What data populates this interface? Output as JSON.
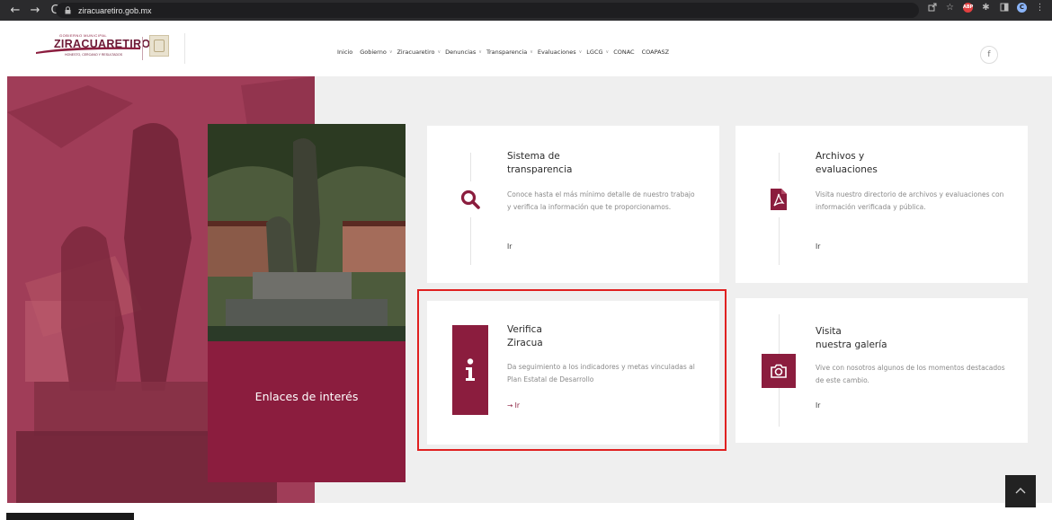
{
  "browser": {
    "back": "←",
    "forward": "→",
    "reload": "C",
    "lock": "🔒",
    "url": "ziracuaretiro.gob.mx",
    "profile": "C"
  },
  "logo": {
    "top": "GOBIERNO MUNICIPAL",
    "name": "ZIRACUARETIRO",
    "tagline": "HONESTO, CERCANO Y RESULTADOS"
  },
  "nav": {
    "items": [
      {
        "label": "Inicio",
        "caret": false
      },
      {
        "label": "Gobierno",
        "caret": true
      },
      {
        "label": "Ziracuaretiro",
        "caret": true
      },
      {
        "label": "Denuncias",
        "caret": true
      },
      {
        "label": "Transparencia",
        "caret": true
      },
      {
        "label": "Evaluaciones",
        "caret": true
      },
      {
        "label": "LGCG",
        "caret": true
      },
      {
        "label": "CONAC",
        "caret": false
      },
      {
        "label": "COAPASZ",
        "caret": false
      }
    ],
    "caret_glyph": "∨",
    "facebook": "f"
  },
  "feature": {
    "label": "Enlaces de interés"
  },
  "cards": [
    {
      "title_line1": "Sistema de",
      "title_line2": "transparencia",
      "desc": "Conoce hasta el más mínimo detalle de nuestro trabajo y verifica la información que te proporcionamos.",
      "link": "Ir",
      "icon": "search-icon"
    },
    {
      "title_line1": "Archivos y",
      "title_line2": "evaluaciones",
      "desc": "Visita nuestro directorio de archivos y evaluaciones con información verificada y pública.",
      "link": "Ir",
      "icon": "pdf-icon"
    },
    {
      "title_line1": "Verifica",
      "title_line2": "Ziracua",
      "desc": "Da seguimiento a los indicadores y metas vinculadas al Plan Estatal de Desarrollo",
      "link": "→ Ir",
      "icon": "info-icon"
    },
    {
      "title_line1": "Visita",
      "title_line2": "nuestra galería",
      "desc": "Vive con nosotros algunos de los momentos destacados de este cambio.",
      "link": "Ir",
      "icon": "camera-icon"
    }
  ],
  "scroll_top": "^",
  "colors": {
    "brand": "#8b1d3e",
    "highlight": "#e02020"
  }
}
